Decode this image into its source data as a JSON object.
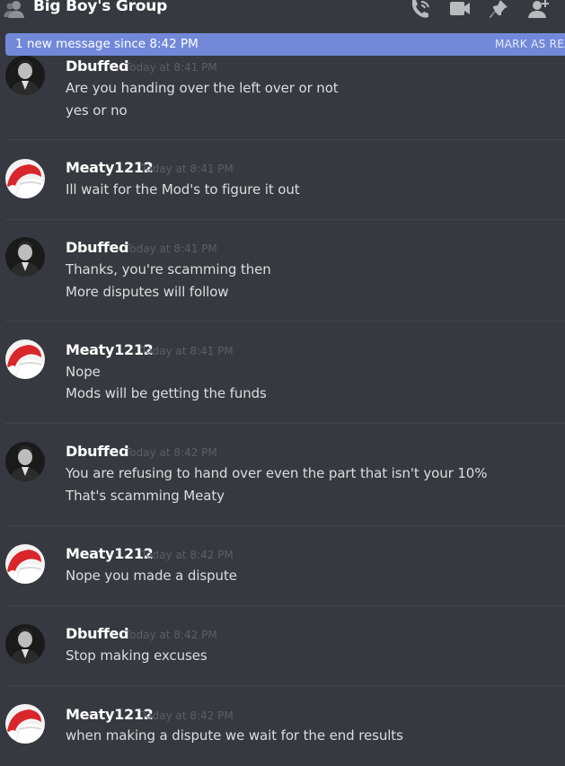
{
  "header": {
    "title": "Big Boy's Group",
    "icons": [
      "group-icon",
      "call-icon",
      "video-icon",
      "pin-icon",
      "add-member-icon"
    ]
  },
  "banner": {
    "text": "1 new message since 8:42 PM",
    "mark_label": "MARK AS REA"
  },
  "messages": [
    {
      "author": "Dbuffed",
      "time": "Today at 8:41 PM",
      "lines": [
        "Are you handing over the left over or not",
        "yes or no"
      ],
      "avatar": "bw-portrait"
    },
    {
      "author": "Meaty1212",
      "time": "Today at 8:41 PM",
      "lines": [
        "Ill wait for the Mod's to figure it out"
      ],
      "avatar": "red-hat"
    },
    {
      "author": "Dbuffed",
      "time": "Today at 8:41 PM",
      "lines": [
        "Thanks, you're scamming then",
        "More disputes will follow"
      ],
      "avatar": "bw-portrait"
    },
    {
      "author": "Meaty1212",
      "time": "Today at 8:41 PM",
      "lines": [
        "Nope",
        "Mods will be getting the funds"
      ],
      "avatar": "red-hat"
    },
    {
      "author": "Dbuffed",
      "time": "Today at 8:42 PM",
      "lines": [
        "You are refusing to hand over even the part that isn't your 10%",
        "That's scamming Meaty"
      ],
      "avatar": "bw-portrait"
    },
    {
      "author": "Meaty1212",
      "time": "Today at 8:42 PM",
      "lines": [
        "Nope you made a dispute"
      ],
      "avatar": "red-hat"
    },
    {
      "author": "Dbuffed",
      "time": "Today at 8:42 PM",
      "lines": [
        "Stop making excuses"
      ],
      "avatar": "bw-portrait"
    },
    {
      "author": "Meaty1212",
      "time": "Today at 8:42 PM",
      "lines": [
        "when making a dispute we wait for the end results"
      ],
      "avatar": "red-hat"
    }
  ],
  "colors": {
    "background": "#36393f",
    "banner": "#7289da",
    "username": "#ffffff",
    "timestamp": "#5c5f66",
    "message_text": "#dcddde"
  }
}
